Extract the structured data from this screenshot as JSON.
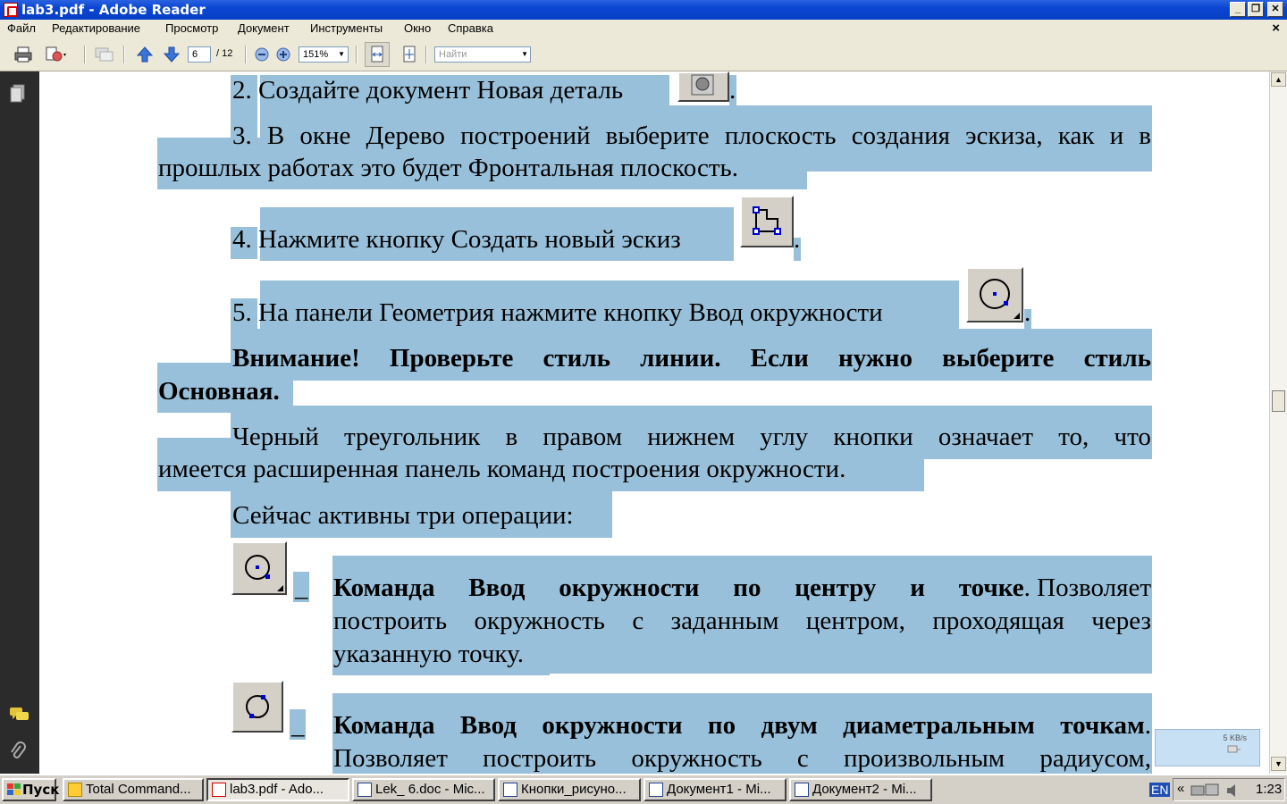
{
  "window": {
    "title": "lab3.pdf - Adobe Reader",
    "min": "_",
    "restore": "❐",
    "close": "✕"
  },
  "menu": [
    "Файл",
    "Редактирование",
    "Просмотр",
    "Документ",
    "Инструменты",
    "Окно",
    "Справка"
  ],
  "menu_close": "×",
  "toolbar": {
    "page_current": "6",
    "page_total": "/ 12",
    "zoom": "151%",
    "find_placeholder": "Найти"
  },
  "document": {
    "p2": {
      "text": "2. Создайте документ Новая деталь",
      "tail": "."
    },
    "p3": {
      "line1": [
        "3.",
        "В",
        "окне",
        "Дерево",
        "построений",
        "выберите",
        "плоскость",
        "создания",
        "эскиза,",
        "как",
        "и",
        "в"
      ],
      "line2": "прошлых работах это будет Фронтальная плоскость."
    },
    "p4": {
      "text": "4. Нажмите кнопку Создать новый эскиз",
      "tail": "."
    },
    "p5": {
      "text": "5. На панели Геометрия нажмите кнопку Ввод окружности",
      "tail": "."
    },
    "warning": {
      "line1": [
        "Внимание!",
        "Проверьте",
        "стиль",
        "линии.",
        "Если",
        "нужно",
        "выберите",
        "стиль"
      ],
      "line2": "Основная."
    },
    "note": {
      "line1": [
        "Черный",
        "треугольник",
        "в",
        "правом",
        "нижнем",
        "углу",
        "кнопки",
        "означает",
        "то,",
        "что"
      ],
      "line2": "имеется расширенная панель команд построения окружности."
    },
    "active_ops": "Сейчас активны три операции:",
    "dash": "_",
    "item1": {
      "title_words": [
        "Команда",
        "Ввод",
        "окружности",
        "по",
        "центру",
        "и",
        "точке"
      ],
      "rest_line1": [
        ". Позволяет"
      ],
      "line2": [
        "построить",
        "окружность",
        "с",
        "заданным",
        "центром,",
        "проходящая",
        "через"
      ],
      "line3": "указанную точку."
    },
    "item2": {
      "title_words": [
        "Команда",
        "Ввод",
        "окружности",
        "по",
        "двум",
        "диаметральным",
        "точкам"
      ],
      "tail": ".",
      "line2": [
        "Позволяет",
        "построить",
        "окружность",
        "с",
        "произвольным",
        "радиусом,"
      ]
    }
  },
  "net_widget": {
    "speed": "5 KB/s"
  },
  "taskbar": {
    "start": "Пуск",
    "tasks": [
      "Total Command...",
      "lab3.pdf - Ado...",
      "Lek_ 6.doc - Mic...",
      "Кнопки_рисуно...",
      "Документ1 - Mi...",
      "Документ2 - Mi..."
    ],
    "lang": "EN",
    "chevron": "«",
    "clock": "1:23"
  },
  "colors": {
    "highlight": "#99c0da",
    "titlebar": "#0a46d2",
    "sidebar": "#2b2b2b"
  },
  "icons": [
    "print-icon",
    "export-icon",
    "comment-icon",
    "arrow-up-icon",
    "arrow-down-icon",
    "zoom-out-icon",
    "zoom-in-icon",
    "fit-width-icon",
    "fit-page-icon",
    "pages-icon",
    "comments-icon",
    "attachments-icon"
  ]
}
